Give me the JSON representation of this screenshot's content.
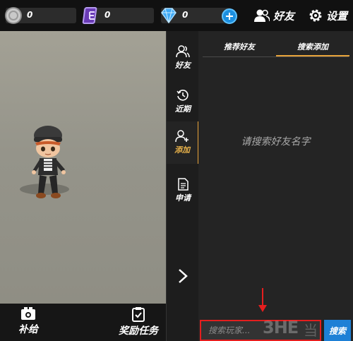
{
  "currencies": [
    {
      "icon": "silver-coin-icon",
      "value": "0"
    },
    {
      "icon": "purple-gem-icon",
      "value": "0"
    },
    {
      "icon": "diamond-icon",
      "value": "0"
    }
  ],
  "topbar": {
    "friends_label": "好友",
    "settings_label": "设置"
  },
  "vnav": [
    {
      "icon": "friends-icon",
      "label": "好友",
      "active": false
    },
    {
      "icon": "recent-clock-icon",
      "label": "近期",
      "active": false
    },
    {
      "icon": "add-friend-icon",
      "label": "添加",
      "active": true
    },
    {
      "icon": "request-document-icon",
      "label": "申请",
      "active": false
    }
  ],
  "tabs": [
    {
      "label": "推荐好友",
      "active": false
    },
    {
      "label": "搜索添加",
      "active": true
    }
  ],
  "panel": {
    "empty_hint": "请搜索好友名字"
  },
  "search": {
    "placeholder": "搜索玩家...",
    "button_label": "搜索"
  },
  "bottom": {
    "supply_label": "补给",
    "reward_label": "奖励任务"
  },
  "watermark": {
    "text": "3HE",
    "text_cn": "当"
  },
  "colors": {
    "accent_orange": "#e8a33a",
    "search_blue": "#1e80d6",
    "highlight_red": "#e51e1e"
  }
}
